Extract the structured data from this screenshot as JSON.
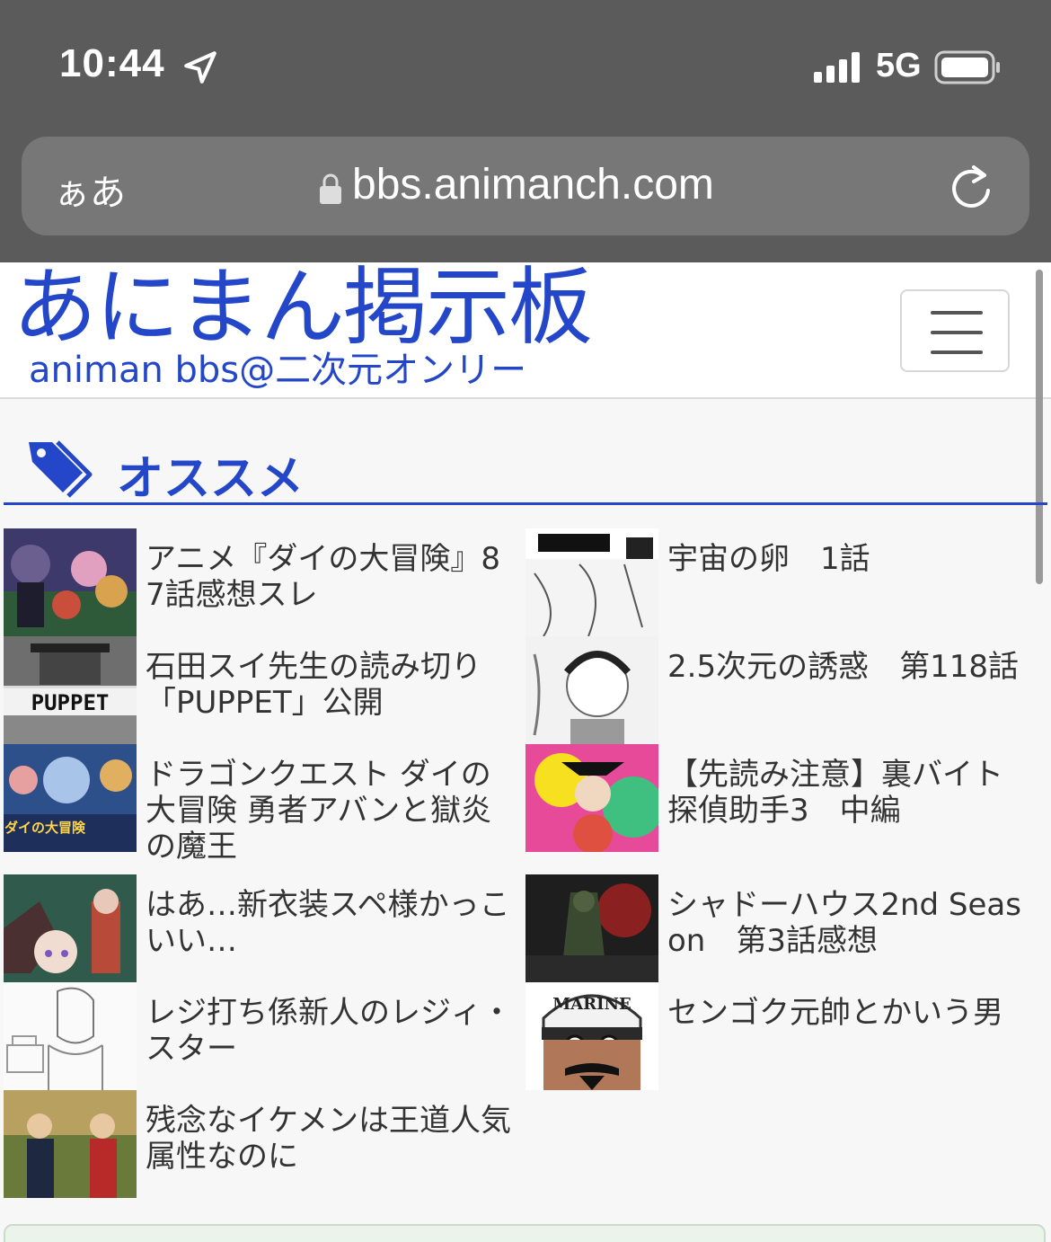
{
  "status_bar": {
    "time": "10:44",
    "network": "5G"
  },
  "browser": {
    "aa_label": "ぁあ",
    "url": "bbs.animanch.com"
  },
  "site": {
    "logo": "あにまん掲示板",
    "logo_sub": "animan bbs@二次元オンリー"
  },
  "section": {
    "title": "オススメ",
    "icon": "tag-icon"
  },
  "items_left": [
    {
      "title": "アニメ『ダイの大冒険』87話感想スレ"
    },
    {
      "title": "石田スイ先生の読み切り「PUPPET」公開"
    },
    {
      "title": "ドラゴンクエスト ダイの大冒険 勇者アバンと獄炎の魔王"
    },
    {
      "title": "はあ…新衣装スペ様かっこいい…"
    },
    {
      "title": "レジ打ち係新人のレジィ・スター"
    },
    {
      "title": "残念なイケメンは王道人気属性なのに"
    }
  ],
  "items_right": [
    {
      "title": "宇宙の卵　1話"
    },
    {
      "title": "2.5次元の誘惑　第118話"
    },
    {
      "title": "【先読み注意】裏バイト 探偵助手3　中編"
    },
    {
      "title": "シャドーハウス2nd Season　第3話感想"
    },
    {
      "title": "センゴク元帥とかいう男"
    }
  ],
  "thumb_labels": {
    "puppet": "PUPPET",
    "marine": "MARINE",
    "dai": "ダイの大冒険"
  },
  "colors": {
    "accent": "#2447c9",
    "chrome": "#5b5b5b"
  }
}
